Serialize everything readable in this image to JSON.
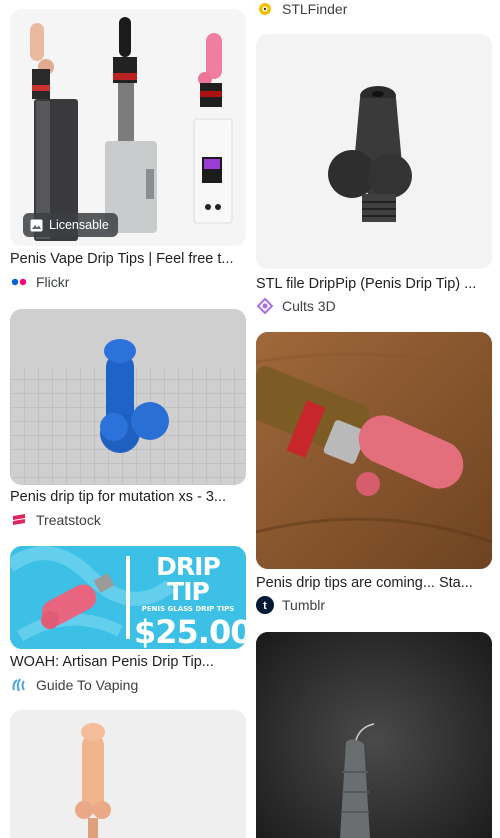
{
  "results_left": [
    {
      "title": "Penis Vape Drip Tips | Feel free t...",
      "source": "Flickr",
      "badge": "Licensable",
      "thumb_icon": "vape-devices-image"
    },
    {
      "title": "Penis drip tip for mutation xs - 3...",
      "source": "Treatstock",
      "thumb_icon": "blue-3d-model-image"
    },
    {
      "title": "WOAH: Artisan Penis Drip Tip...",
      "source": "Guide To Vaping",
      "banner_line1": "DRIP TIP",
      "banner_line2": "PENIS GLASS DRIP TIPS",
      "banner_price": "$25.00",
      "thumb_icon": "pink-drip-tip-image"
    },
    {
      "thumb_icon": "peach-drip-tip-image"
    }
  ],
  "results_right": [
    {
      "source": "STLFinder"
    },
    {
      "title": "STL file DripPip (Penis Drip Tip) ...",
      "source": "Cults 3D",
      "thumb_icon": "black-drip-tip-image"
    },
    {
      "title": "Penis drip tips are coming... Sta...",
      "source": "Tumblr",
      "thumb_icon": "pink-tip-on-table-image"
    },
    {
      "thumb_icon": "grey-3d-print-image"
    }
  ],
  "colors": {
    "flickr_blue": "#0063dc",
    "flickr_pink": "#ff0084",
    "treatstock": "#e0245e",
    "cults": "#a86fe6",
    "tumblr": "#001935",
    "banner_bg": "#3cc0e6",
    "stlfinder": "#f2c200"
  }
}
